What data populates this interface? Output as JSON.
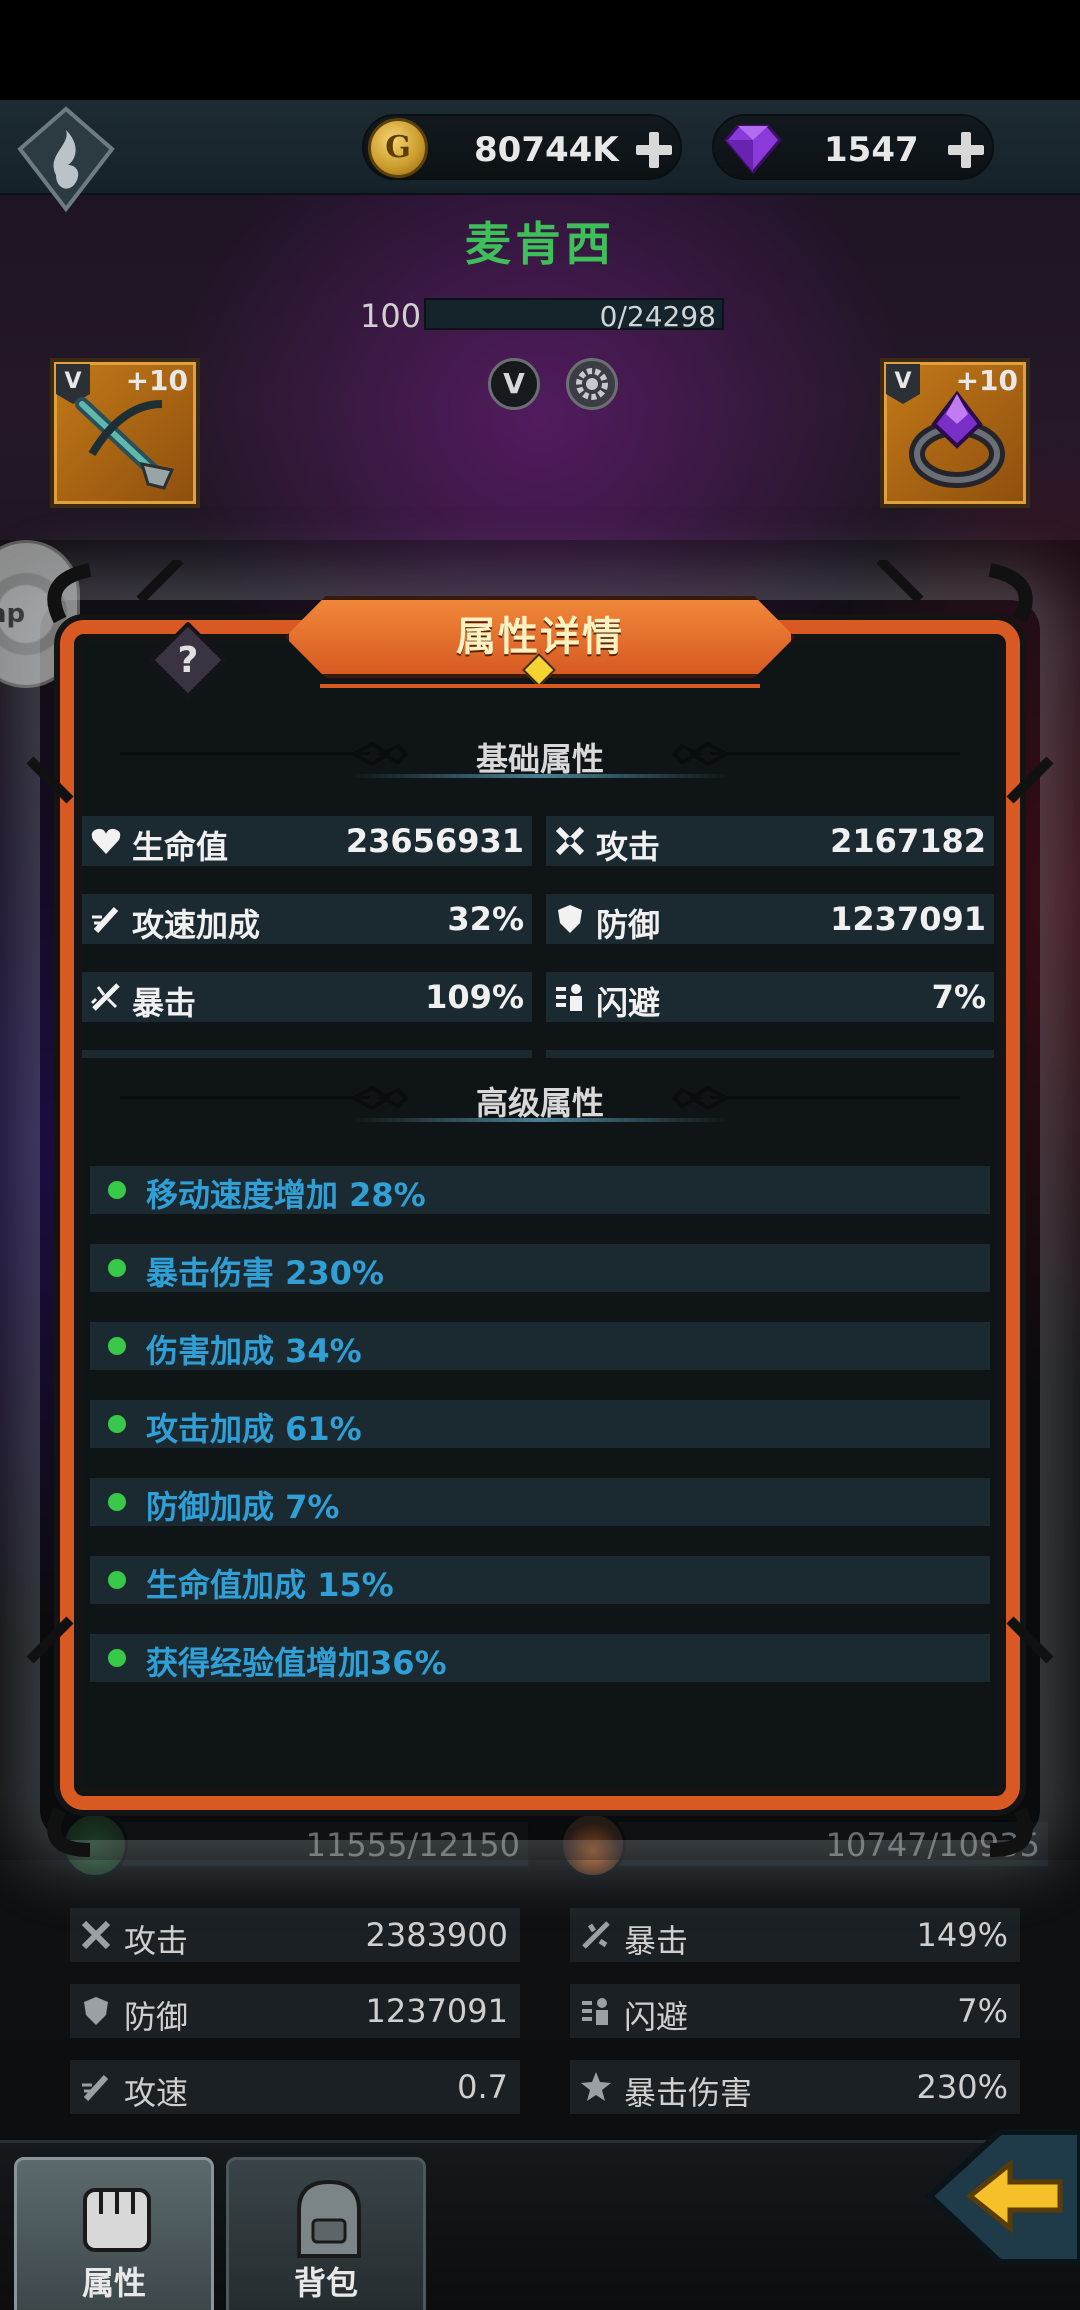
{
  "header": {
    "gold": "80744K",
    "gold_symbol": "G",
    "gems": "1547",
    "character_name": "麦肯西",
    "level": "100",
    "xp": "0/24298",
    "xp_fraction": 0,
    "vip_label": "V",
    "left_equip": {
      "tier": "V",
      "plus": "+10"
    },
    "right_equip": {
      "tier": "V",
      "plus": "+10"
    },
    "side_bubble": "ap"
  },
  "modal": {
    "title": "属性详情",
    "basic_title": "基础属性",
    "basic_stats": [
      {
        "icon": "heart-icon",
        "label": "生命值",
        "value": "23656931"
      },
      {
        "icon": "attack-icon",
        "label": "攻击",
        "value": "2167182"
      },
      {
        "icon": "attack-speed-icon",
        "label": "攻速加成",
        "value": "32%"
      },
      {
        "icon": "shield-icon",
        "label": "防御",
        "value": "1237091"
      },
      {
        "icon": "crit-icon",
        "label": "暴击",
        "value": "109%"
      },
      {
        "icon": "dodge-icon",
        "label": "闪避",
        "value": "7%"
      }
    ],
    "advanced_title": "高级属性",
    "advanced_stats": [
      "移动速度增加 28%",
      "暴击伤害 230%",
      "伤害加成 34%",
      "攻击加成 61%",
      "防御加成 7%",
      "生命值加成 15%",
      "获得经验值增加36%"
    ]
  },
  "background_panel": {
    "hp_bar": "11555/12150",
    "food_bar": "10747/10935",
    "stats": [
      {
        "icon": "attack-icon",
        "label": "攻击",
        "value": "2383900"
      },
      {
        "icon": "crit-icon",
        "label": "暴击",
        "value": "149%"
      },
      {
        "icon": "shield-icon",
        "label": "防御",
        "value": "1237091"
      },
      {
        "icon": "dodge-icon",
        "label": "闪避",
        "value": "7%"
      },
      {
        "icon": "attack-speed-icon",
        "label": "攻速",
        "value": "0.7"
      },
      {
        "icon": "crit-damage-icon",
        "label": "暴击伤害",
        "value": "230%"
      }
    ]
  },
  "bottom_nav": {
    "tabs": [
      {
        "label": "属性",
        "icon": "fist-icon",
        "active": true
      },
      {
        "label": "背包",
        "icon": "backpack-icon",
        "active": false
      }
    ],
    "back_icon": "back-arrow-icon"
  },
  "colors": {
    "accent_orange": "#d85a22",
    "name_green": "#3fbf5a",
    "advanced_blue": "#2f9fd6",
    "dot_green": "#38c84a"
  }
}
